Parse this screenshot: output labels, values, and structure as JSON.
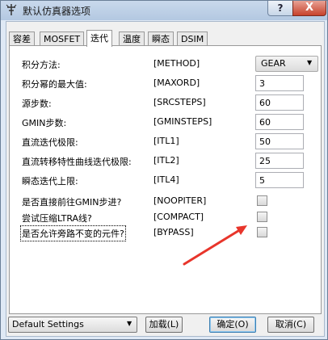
{
  "window": {
    "title": "默认仿真器选项",
    "help_label": "?",
    "close_label": "X"
  },
  "tabs": [
    {
      "label": "容差"
    },
    {
      "label": "MOSFET"
    },
    {
      "label": "迭代"
    },
    {
      "label": "温度"
    },
    {
      "label": "瞬态"
    },
    {
      "label": "DSIM"
    }
  ],
  "active_tab": "迭代",
  "options": [
    {
      "label": "积分方法:",
      "key": "[METHOD]",
      "type": "select",
      "value": "GEAR"
    },
    {
      "label": "积分幂的最大值:",
      "key": "[MAXORD]",
      "type": "number",
      "value": "3"
    },
    {
      "label": "源步数:",
      "key": "[SRCSTEPS]",
      "type": "number",
      "value": "60"
    },
    {
      "label": "GMIN步数:",
      "key": "[GMINSTEPS]",
      "type": "number",
      "value": "60"
    },
    {
      "label": "直流迭代极限:",
      "key": "[ITL1]",
      "type": "number",
      "value": "50"
    },
    {
      "label": "直流转移特性曲线迭代极限:",
      "key": "[ITL2]",
      "type": "number",
      "value": "25"
    },
    {
      "label": "瞬态迭代上限:",
      "key": "[ITL4]",
      "type": "number",
      "value": "5"
    },
    {
      "label": "是否直接前往GMIN步进?",
      "key": "[NOOPITER]",
      "type": "checkbox",
      "checked": false
    },
    {
      "label": "尝试压缩LTRA线?",
      "key": "[COMPACT]",
      "type": "checkbox",
      "checked": false
    },
    {
      "label": "是否允许旁路不变的元件?",
      "key": "[BYPASS]",
      "type": "checkbox",
      "checked": false
    }
  ],
  "footer": {
    "settings_value": "Default Settings",
    "load_label": "加载(L)",
    "ok_label": "确定(O)",
    "cancel_label": "取消(C)"
  },
  "annotation": {
    "arrow_color": "#e8352b"
  }
}
